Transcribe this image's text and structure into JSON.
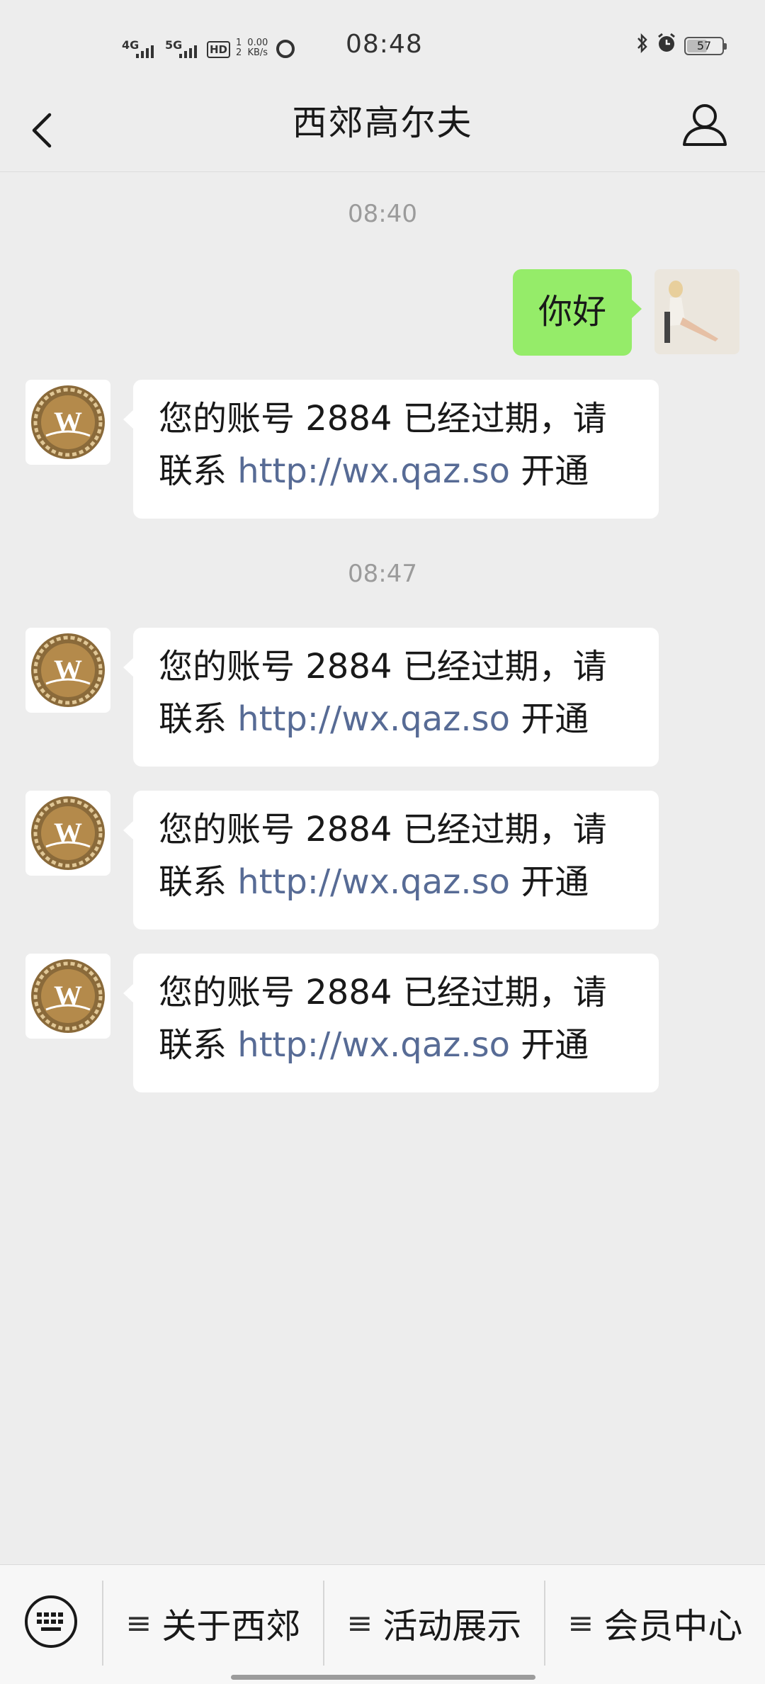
{
  "status_bar": {
    "time": "08:48",
    "network1": "4G",
    "network2": "5G",
    "hd_label": "HD",
    "hd_sub1": "1",
    "hd_sub2": "2",
    "speed_value": "0.00",
    "speed_unit": "KB/s",
    "battery_level": "57"
  },
  "header": {
    "title": "西郊高尔夫"
  },
  "chat": {
    "timestamp1": "08:40",
    "my_message": "你好",
    "timestamp2": "08:47",
    "bot_messages": [
      {
        "prefix": "您的账号 2884 已经过期，请联系 ",
        "link": "http://wx.qaz.so",
        "suffix": " 开通"
      },
      {
        "prefix": "您的账号 2884 已经过期，请联系 ",
        "link": "http://wx.qaz.so",
        "suffix": " 开通"
      },
      {
        "prefix": "您的账号 2884 已经过期，请联系 ",
        "link": "http://wx.qaz.so",
        "suffix": " 开通"
      },
      {
        "prefix": "您的账号 2884 已经过期，请联系 ",
        "link": "http://wx.qaz.so",
        "suffix": " 开通"
      }
    ]
  },
  "bottom_menu": {
    "items": [
      {
        "label": "关于西郊",
        "icon": "≡"
      },
      {
        "label": "活动展示",
        "icon": "≡"
      },
      {
        "label": "会员中心",
        "icon": "≡"
      }
    ]
  },
  "colors": {
    "background": "#ededed",
    "my_bubble": "#95ec69",
    "link": "#576b95",
    "bot_logo_gold": "#a0773a"
  }
}
